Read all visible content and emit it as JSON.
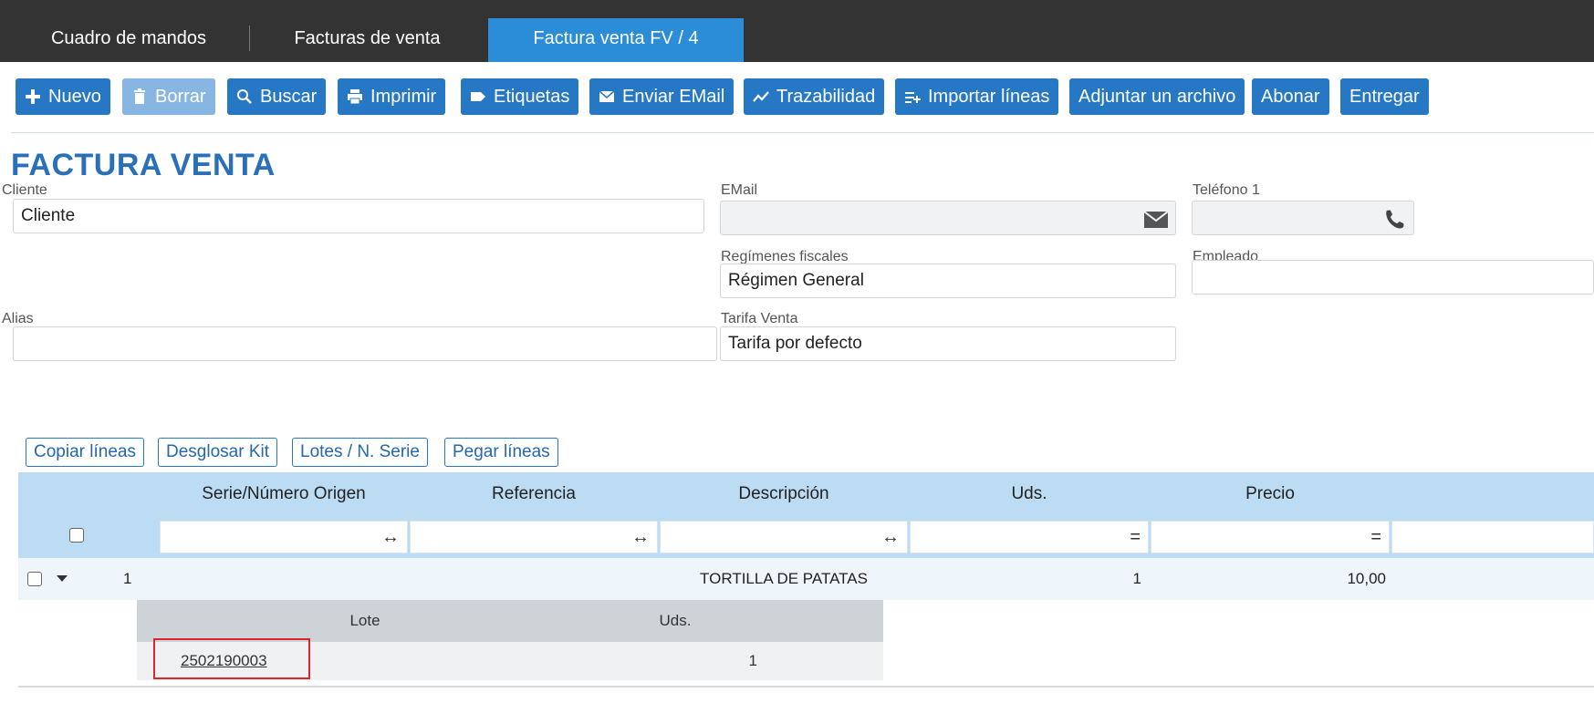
{
  "tabs": [
    {
      "label": "Cuadro de mandos",
      "active": false
    },
    {
      "label": "Facturas de venta",
      "active": false
    },
    {
      "label": "Factura venta FV / 4",
      "active": true
    }
  ],
  "toolbar": {
    "nuevo": "Nuevo",
    "borrar": "Borrar",
    "buscar": "Buscar",
    "imprimir": "Imprimir",
    "etiquetas": "Etiquetas",
    "enviar_email": "Enviar EMail",
    "trazabilidad": "Trazabilidad",
    "importar_lineas": "Importar líneas",
    "adjuntar": "Adjuntar un archivo",
    "abonar": "Abonar",
    "entregar": "Entregar"
  },
  "page_title": "FACTURA VENTA",
  "form": {
    "cliente_label": "Cliente",
    "cliente_value": "Cliente",
    "email_label": "EMail",
    "email_value": "",
    "telefono_label": "Teléfono 1",
    "telefono_value": "",
    "regimen_label": "Regímenes fiscales",
    "regimen_value": "Régimen General",
    "empleado_label": "Empleado",
    "empleado_value": "",
    "alias_label": "Alias",
    "alias_value": "",
    "tarifa_label": "Tarifa Venta",
    "tarifa_value": "Tarifa por defecto"
  },
  "line_actions": {
    "copiar": "Copiar líneas",
    "desglosar": "Desglosar Kit",
    "lotes": "Lotes / N. Serie",
    "pegar": "Pegar líneas"
  },
  "grid": {
    "columns": [
      "Serie/Número Origen",
      "Referencia",
      "Descripción",
      "Uds.",
      "Precio"
    ],
    "filter_symbols": [
      "↔",
      "↔",
      "↔",
      "=",
      "="
    ],
    "rows": [
      {
        "num": "1",
        "descripcion": "TORTILLA DE PATATAS",
        "uds": "1",
        "precio": "10,00"
      }
    ]
  },
  "lots": {
    "columns": [
      "Lote",
      "Uds."
    ],
    "rows": [
      {
        "lote": "2502190003",
        "uds": "1"
      }
    ]
  },
  "colors": {
    "tabbar": "#333333",
    "active_tab": "#2b8cd8",
    "button": "#2778c4",
    "title": "#2a70b8",
    "highlight": "#d9262b"
  }
}
